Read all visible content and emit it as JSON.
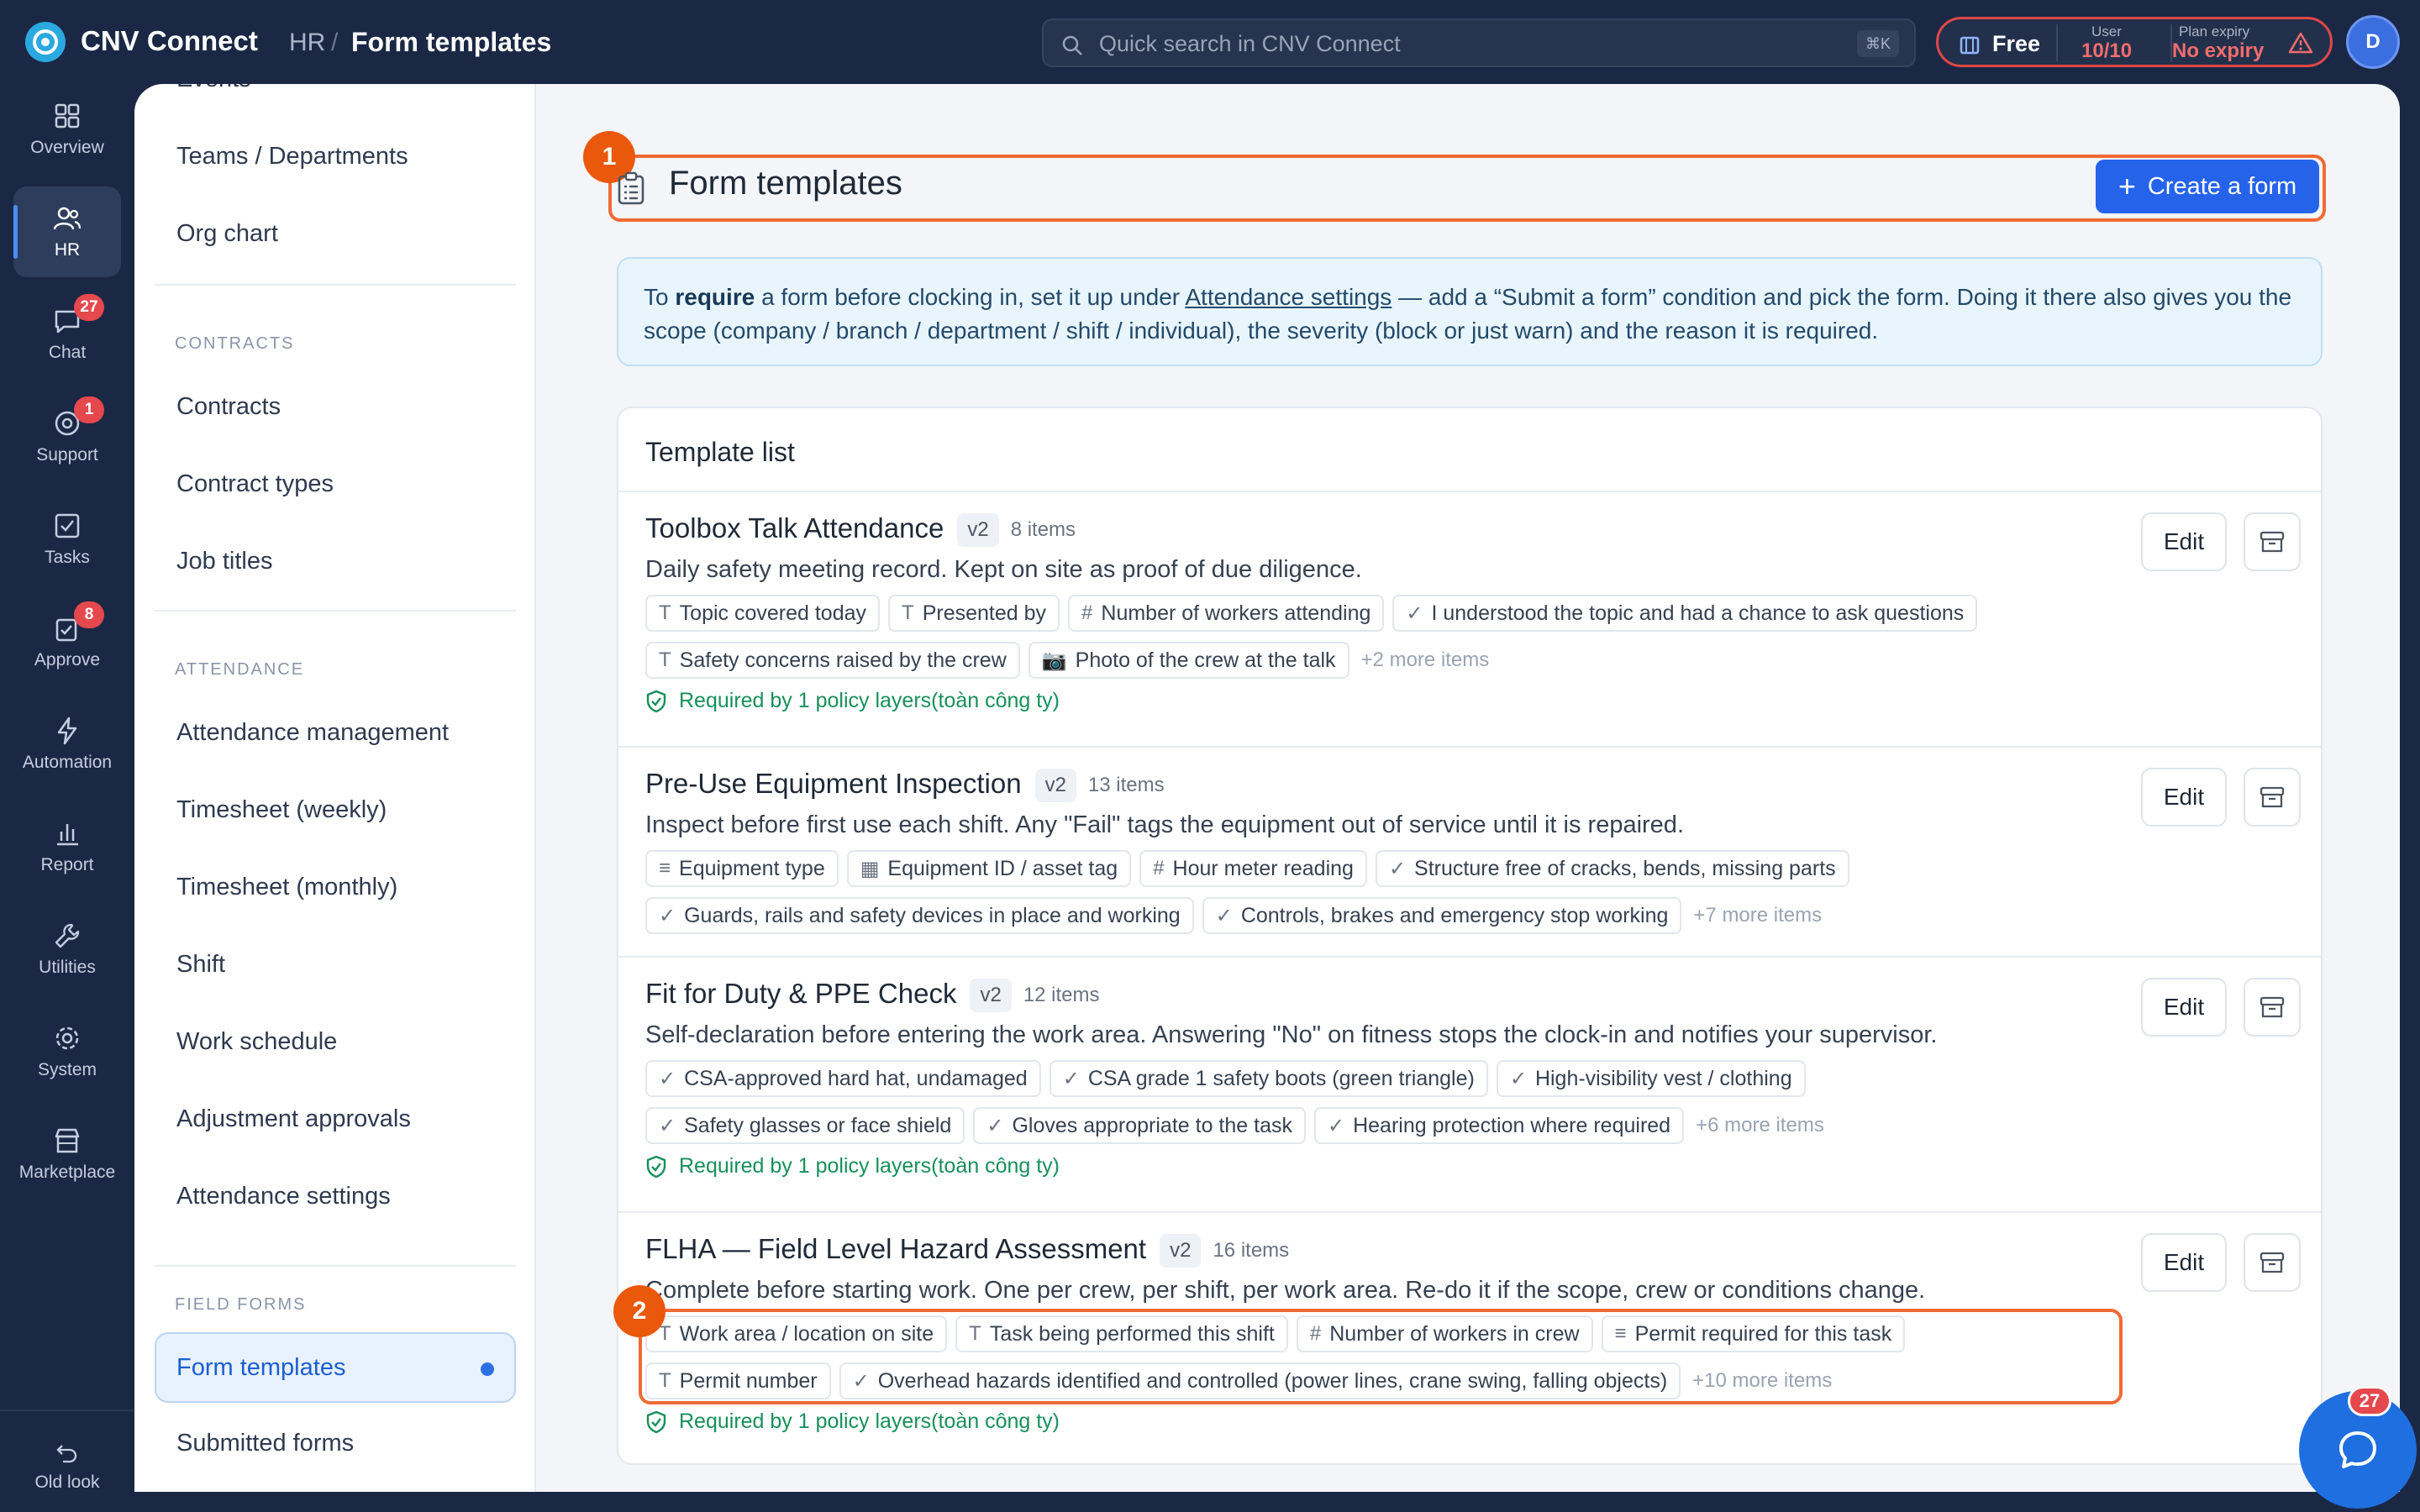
{
  "app": {
    "name": "CNV Connect"
  },
  "breadcrumb": {
    "section": "HR",
    "separator": "/",
    "current": "Form templates"
  },
  "search": {
    "placeholder": "Quick search in CNV Connect",
    "shortcut": "⌘K"
  },
  "plan": {
    "name": "Free",
    "user_label": "User",
    "user_value": "10/10",
    "expiry_label": "Plan expiry",
    "expiry_value": "No expiry",
    "alert_color": "#e04848"
  },
  "user": {
    "avatar_initial": "D"
  },
  "rail": {
    "items": [
      {
        "label": "Overview",
        "icon": "grid-icon"
      },
      {
        "label": "HR",
        "icon": "users-icon",
        "active": true
      },
      {
        "label": "Chat",
        "icon": "chat-icon",
        "badge": "27"
      },
      {
        "label": "Support",
        "icon": "support-icon",
        "badge": "1"
      },
      {
        "label": "Tasks",
        "icon": "check-square-icon"
      },
      {
        "label": "Approve",
        "icon": "approve-icon",
        "badge": "8"
      },
      {
        "label": "Automation",
        "icon": "lightning-icon"
      },
      {
        "label": "Report",
        "icon": "bar-chart-icon"
      },
      {
        "label": "Utilities",
        "icon": "wrench-icon"
      },
      {
        "label": "System",
        "icon": "gear-icon"
      },
      {
        "label": "Marketplace",
        "icon": "store-icon"
      }
    ],
    "old_look": "Old look"
  },
  "sidebar": {
    "cut_item": "Events",
    "top_items": [
      "Teams / Departments",
      "Org chart"
    ],
    "contracts_heading": "CONTRACTS",
    "contracts": [
      "Contracts",
      "Contract types",
      "Job titles"
    ],
    "attendance_heading": "ATTENDANCE",
    "attendance": [
      "Attendance management",
      "Timesheet (weekly)",
      "Timesheet (monthly)",
      "Shift",
      "Work schedule",
      "Adjustment approvals",
      "Attendance settings"
    ],
    "field_forms_heading": "FIELD FORMS",
    "active_item": "Form templates",
    "after_active": "Submitted forms"
  },
  "page": {
    "title": "Form templates",
    "create_button": "Create a form",
    "annotation_1": "1",
    "annotation_2": "2"
  },
  "info": {
    "t1": "To ",
    "t2": "require",
    "t3": " a form before clocking in, set it up under ",
    "t4": "Attendance settings",
    "t5": " — add a “Submit a form” condition and pick the form. Doing it there also gives you the scope (company / branch / department / shift / individual), the severity (block or just warn) and the reason it is required."
  },
  "list": {
    "heading": "Template list",
    "edit_label": "Edit",
    "templates": [
      {
        "name": "Toolbox Talk Attendance",
        "version": "v2",
        "count": "8 items",
        "description": "Daily safety meeting record. Kept on site as proof of due diligence.",
        "row1": [
          {
            "icon": "T",
            "label": "Topic covered today"
          },
          {
            "icon": "T",
            "label": "Presented by"
          },
          {
            "icon": "#",
            "label": "Number of workers attending"
          },
          {
            "icon": "✓",
            "label": "I understood the topic and had a chance to ask questions"
          }
        ],
        "row2": [
          {
            "icon": "T",
            "label": "Safety concerns raised by the crew"
          },
          {
            "icon": "📷",
            "label": "Photo of the crew at the talk"
          }
        ],
        "more": "+2 more items",
        "required": "Required by 1 policy layers(toàn công ty)"
      },
      {
        "name": "Pre-Use Equipment Inspection",
        "version": "v2",
        "count": "13 items",
        "description": "Inspect before first use each shift. Any \"Fail\" tags the equipment out of service until it is repaired.",
        "row1": [
          {
            "icon": "≡",
            "label": "Equipment type"
          },
          {
            "icon": "▦",
            "label": "Equipment ID / asset tag"
          },
          {
            "icon": "#",
            "label": "Hour meter reading"
          },
          {
            "icon": "✓",
            "label": "Structure free of cracks, bends, missing parts"
          }
        ],
        "row2": [
          {
            "icon": "✓",
            "label": "Guards, rails and safety devices in place and working"
          },
          {
            "icon": "✓",
            "label": "Controls, brakes and emergency stop working"
          }
        ],
        "more": "+7 more items",
        "required": ""
      },
      {
        "name": "Fit for Duty & PPE Check",
        "version": "v2",
        "count": "12 items",
        "description": "Self-declaration before entering the work area. Answering \"No\" on fitness stops the clock-in and notifies your supervisor.",
        "row1": [
          {
            "icon": "✓",
            "label": "CSA-approved hard hat, undamaged"
          },
          {
            "icon": "✓",
            "label": "CSA grade 1 safety boots (green triangle)"
          },
          {
            "icon": "✓",
            "label": "High-visibility vest / clothing"
          }
        ],
        "row2": [
          {
            "icon": "✓",
            "label": "Safety glasses or face shield"
          },
          {
            "icon": "✓",
            "label": "Gloves appropriate to the task"
          },
          {
            "icon": "✓",
            "label": "Hearing protection where required"
          }
        ],
        "more": "+6 more items",
        "required": "Required by 1 policy layers(toàn công ty)"
      },
      {
        "name": "FLHA — Field Level Hazard Assessment",
        "version": "v2",
        "count": "16 items",
        "description": "Complete before starting work. One per crew, per shift, per work area. Re-do it if the scope, crew or conditions change.",
        "row1": [
          {
            "icon": "T",
            "label": "Work area / location on site"
          },
          {
            "icon": "T",
            "label": "Task being performed this shift"
          },
          {
            "icon": "#",
            "label": "Number of workers in crew"
          },
          {
            "icon": "≡",
            "label": "Permit required for this task"
          }
        ],
        "row2": [
          {
            "icon": "T",
            "label": "Permit number"
          },
          {
            "icon": "✓",
            "label": "Overhead hazards identified and controlled (power lines, crane swing, falling objects)"
          }
        ],
        "more": "+10 more items",
        "required": "Required by 1 policy layers(toàn công ty)"
      }
    ]
  },
  "chat_fab": {
    "badge": "27"
  },
  "colors": {
    "accent": "#2563eb",
    "highlight": "#f06a35",
    "rail_bg": "#1b2845",
    "success": "#17905a",
    "badge": "#e5484d"
  }
}
